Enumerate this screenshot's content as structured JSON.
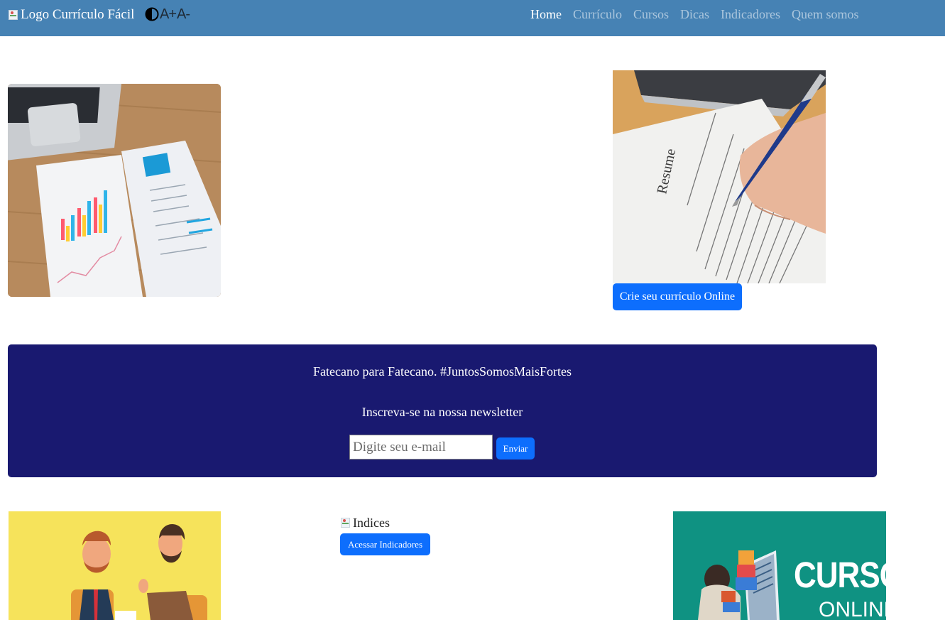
{
  "navbar": {
    "logo_alt": "Logo Currículo Fácil",
    "font_increase": "A+",
    "font_decrease": "A-",
    "links": [
      "Home",
      "Currículo",
      "Cursos",
      "Dicas",
      "Indicadores",
      "Quem somos"
    ],
    "active": "Home",
    "bg_color": "#4682b4"
  },
  "hero": {
    "create_button": "Crie seu currículo Online"
  },
  "newsletter": {
    "tagline": "Fatecano para Fatecano. #JuntosSomosMaisFortes",
    "heading": "Inscreva-se na nossa newsletter",
    "email_placeholder": "Digite seu e-mail",
    "send_button": "Enviar",
    "bg_color": "#191970"
  },
  "indicators": {
    "image_alt": "Indices",
    "button": "Acessar Indicadores"
  },
  "courses": {
    "banner_title": "CURSOS",
    "banner_subtitle": "ONLINE"
  },
  "accent_color": "#0d6efd"
}
